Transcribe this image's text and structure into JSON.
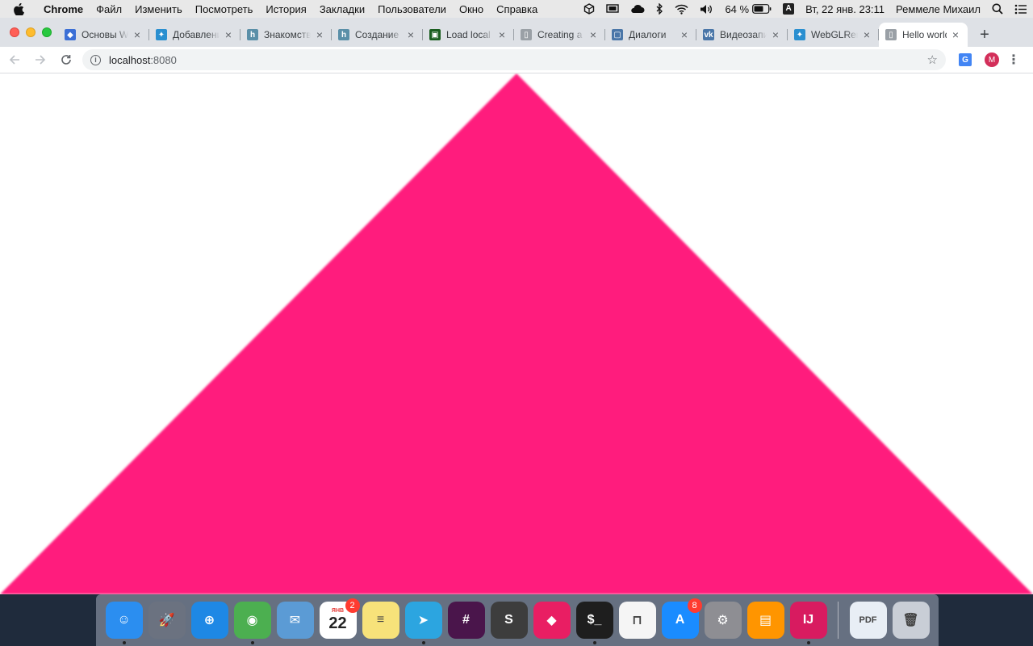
{
  "menubar": {
    "app_name": "Chrome",
    "items": [
      "Файл",
      "Изменить",
      "Посмотреть",
      "История",
      "Закладки",
      "Пользователи",
      "Окно",
      "Справка"
    ],
    "battery": "64 %",
    "input_source": "A",
    "datetime": "Вт, 22 янв.  23:11",
    "user": "Реммеле Михаил"
  },
  "tabs": [
    {
      "title": "Основы WebGL",
      "favicon_color": "#3b6fd6",
      "favicon_glyph": "◆",
      "close": "×"
    },
    {
      "title": "Добавление",
      "favicon_color": "#2a8fd0",
      "favicon_glyph": "✦",
      "close": "×"
    },
    {
      "title": "Знакомство",
      "favicon_color": "#5a8fa8",
      "favicon_glyph": "h",
      "close": "×"
    },
    {
      "title": "Создание",
      "favicon_color": "#5a8fa8",
      "favicon_glyph": "h",
      "close": "×"
    },
    {
      "title": "Load local",
      "favicon_color": "#1b5e20",
      "favicon_glyph": "▣",
      "close": "×"
    },
    {
      "title": "Creating a",
      "favicon_color": "#9aa0a6",
      "favicon_glyph": "▯",
      "close": "×"
    },
    {
      "title": "Диалоги",
      "favicon_color": "#4a76a8",
      "favicon_glyph": "▢",
      "close": "×"
    },
    {
      "title": "Видеозапи",
      "favicon_color": "#4a76a8",
      "favicon_glyph": "vk",
      "close": "×"
    },
    {
      "title": "WebGLRen",
      "favicon_color": "#2a8fd0",
      "favicon_glyph": "✦",
      "close": "×"
    },
    {
      "title": "Hello world",
      "favicon_color": "#9aa0a6",
      "favicon_glyph": "▯",
      "close": "×",
      "active": true
    }
  ],
  "toolbar": {
    "url_host": "localhost",
    "url_port": ":8080",
    "avatar_initial": "M"
  },
  "canvas": {
    "shape": "triangle",
    "fill": "#ff1f7d",
    "background": "#ffffff"
  },
  "dock": {
    "items": [
      {
        "name": "finder",
        "color": "#2b8ef0",
        "glyph": "☺",
        "running": true
      },
      {
        "name": "launchpad",
        "color": "#6b7280",
        "glyph": "🚀",
        "running": false
      },
      {
        "name": "safari",
        "color": "#1e88e5",
        "glyph": "⊕",
        "running": false
      },
      {
        "name": "chrome",
        "color": "#4caf50",
        "glyph": "◉",
        "running": true
      },
      {
        "name": "mail",
        "color": "#5b9bd5",
        "glyph": "✉",
        "running": false
      },
      {
        "name": "calendar",
        "month": "ЯНВ",
        "day": "22",
        "badge": "2",
        "running": false
      },
      {
        "name": "notes",
        "color": "#f7e27a",
        "glyph": "≡",
        "running": false
      },
      {
        "name": "telegram",
        "color": "#2ca5e0",
        "glyph": "➤",
        "running": true
      },
      {
        "name": "slack",
        "color": "#4a154b",
        "glyph": "#",
        "running": false
      },
      {
        "name": "sublime-text",
        "color": "#3d3d3d",
        "glyph": "S",
        "running": false
      },
      {
        "name": "webstorm",
        "color": "#e91e63",
        "glyph": "◆",
        "running": false
      },
      {
        "name": "terminal",
        "color": "#1e1e1e",
        "glyph": "$_",
        "running": true
      },
      {
        "name": "pastebot",
        "color": "#f5f5f5",
        "glyph": "⊓",
        "running": false
      },
      {
        "name": "app-store",
        "color": "#1a8cff",
        "glyph": "A",
        "badge": "8",
        "running": false
      },
      {
        "name": "system-preferences",
        "color": "#8e8e93",
        "glyph": "⚙",
        "running": false
      },
      {
        "name": "ibooks",
        "color": "#ff9500",
        "glyph": "▤",
        "running": false
      },
      {
        "name": "intellij-idea",
        "color": "#d81b60",
        "glyph": "IJ",
        "running": true
      }
    ],
    "trailing": [
      {
        "name": "pdf-document",
        "color": "#e8eef5",
        "glyph": "PDF"
      },
      {
        "name": "trash",
        "color": "#c9ced6",
        "glyph": "🗑"
      }
    ]
  }
}
